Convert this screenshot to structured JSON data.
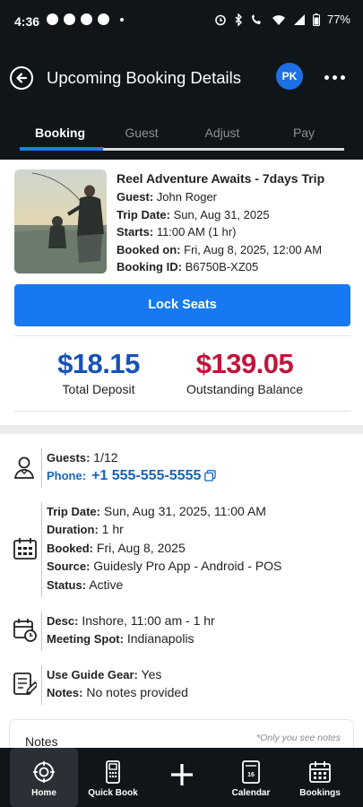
{
  "status_bar": {
    "time": "4:36",
    "battery": "77%"
  },
  "header": {
    "title": "Upcoming Booking Details",
    "avatar_initials": "PK"
  },
  "tabs": [
    {
      "label": "Booking",
      "active": true
    },
    {
      "label": "Guest",
      "active": false
    },
    {
      "label": "Adjust",
      "active": false
    },
    {
      "label": "Pay",
      "active": false
    }
  ],
  "booking": {
    "title": "Reel Adventure Awaits - 7days Trip",
    "guest_label": "Guest:",
    "guest": "John Roger",
    "trip_date_label": "Trip Date:",
    "trip_date": "Sun, Aug 31, 2025",
    "starts_label": "Starts:",
    "starts": "11:00 AM (1 hr)",
    "booked_on_label": "Booked on:",
    "booked_on": "Fri, Aug 8, 2025, 12:00 AM",
    "booking_id_label": "Booking ID:",
    "booking_id": "B6750B-XZ05",
    "lock_button": "Lock Seats"
  },
  "amounts": {
    "deposit": "$18.15",
    "deposit_label": "Total Deposit",
    "deposit_color": "#1552b8",
    "outstanding": "$139.05",
    "outstanding_label": "Outstanding Balance",
    "outstanding_color": "#c0143c"
  },
  "details": {
    "guests_label": "Guests:",
    "guests": "1/12",
    "phone_label": "Phone:",
    "phone": "+1 555-555-5555",
    "trip_date_label": "Trip Date:",
    "trip_date": "Sun, Aug 31, 2025, 11:00 AM",
    "duration_label": "Duration:",
    "duration": "1 hr",
    "booked_label": "Booked:",
    "booked": "Fri, Aug 8, 2025",
    "source_label": "Source:",
    "source": "Guidesly Pro App - Android - POS",
    "status_label": "Status:",
    "status": "Active",
    "desc_label": "Desc:",
    "desc": "Inshore, 11:00 am - 1 hr",
    "meeting_label": "Meeting Spot:",
    "meeting": "Indianapolis",
    "gear_label": "Use Guide Gear:",
    "gear": "Yes",
    "notes_label": "Notes:",
    "notes": "No notes provided"
  },
  "notes_section": {
    "title": "Notes",
    "hint": "*Only you see notes"
  },
  "bottom_nav": [
    {
      "label": "Home",
      "icon": "home-target-icon",
      "active": true
    },
    {
      "label": "Quick Book",
      "icon": "pos-terminal-icon",
      "active": false
    },
    {
      "label": "",
      "icon": "plus-icon",
      "active": false
    },
    {
      "label": "Calendar",
      "icon": "calendar-day-icon",
      "active": false
    },
    {
      "label": "Bookings",
      "icon": "calendar-grid-icon",
      "active": false
    }
  ],
  "colors": {
    "accent": "#1779f2",
    "header_bg": "#0f1518"
  }
}
